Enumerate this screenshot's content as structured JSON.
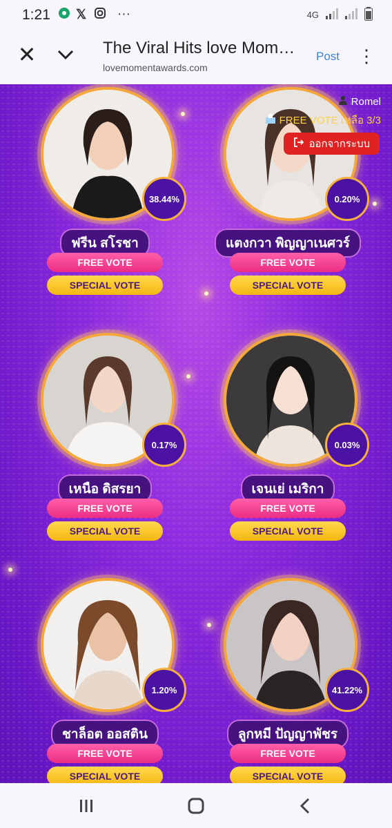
{
  "status": {
    "time": "1:21",
    "network": "4G"
  },
  "toolbar": {
    "title": "The Viral Hits love Mom…",
    "url": "lovemomentawards.com",
    "post_label": "Post"
  },
  "user": {
    "name": "Romel",
    "free_vote_status": "FREE VOTE เหลือ 3/3",
    "logout_label": "ออกจากระบบ"
  },
  "buttons": {
    "free_vote": "FREE VOTE",
    "special_vote": "SPECIAL VOTE"
  },
  "candidates": [
    {
      "name": "ฟรีน สโรชา",
      "percent": "38.44%"
    },
    {
      "name": "แตงกวา พิญญาเนศวร์",
      "percent": "0.20%"
    },
    {
      "name": "เหนือ ดิสรยา",
      "percent": "0.17%"
    },
    {
      "name": "เจนเย่ เมริกา",
      "percent": "0.03%"
    },
    {
      "name": "ชาล็อต ออสติน",
      "percent": "1.20%"
    },
    {
      "name": "ลูกหมี ปัญญาพัชร",
      "percent": "41.22%"
    }
  ],
  "colors": {
    "background": "#7b22d6",
    "free_vote": "#ec2d84",
    "special_vote": "#f4b712",
    "accent_ring": "#f4a73a",
    "logout": "#e02222"
  }
}
